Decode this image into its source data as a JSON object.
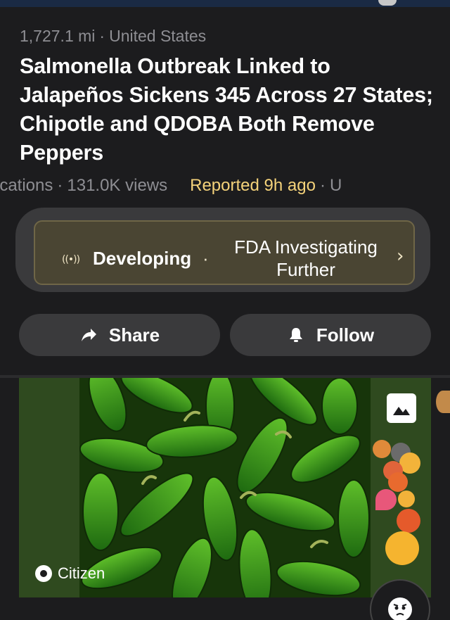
{
  "header": {
    "distance": "1,727.1 mi",
    "separator": "·",
    "location": "United States"
  },
  "headline": "Salmonella Outbreak Linked to Jalapeños Sickens 345 Across 27 States; Chipotle and QDOBA Both Remove Peppers",
  "stats": {
    "notifications_fragment": "ications",
    "views": "131.0K views",
    "reported": "Reported 9h ago",
    "trailing_fragment": "U"
  },
  "developing": {
    "icon": "broadcast-icon",
    "label": "Developing",
    "separator": "·",
    "status": "FDA Investigating Further",
    "chevron": "›"
  },
  "actions": {
    "share_label": "Share",
    "follow_label": "Follow"
  },
  "media": {
    "brand": "Citizen",
    "gallery_icon": "image-icon"
  },
  "colors": {
    "background": "#1c1c1e",
    "reported_accent": "#f4d27a",
    "developing_bg": "#4a4533",
    "button_bg": "#3a3a3c"
  }
}
